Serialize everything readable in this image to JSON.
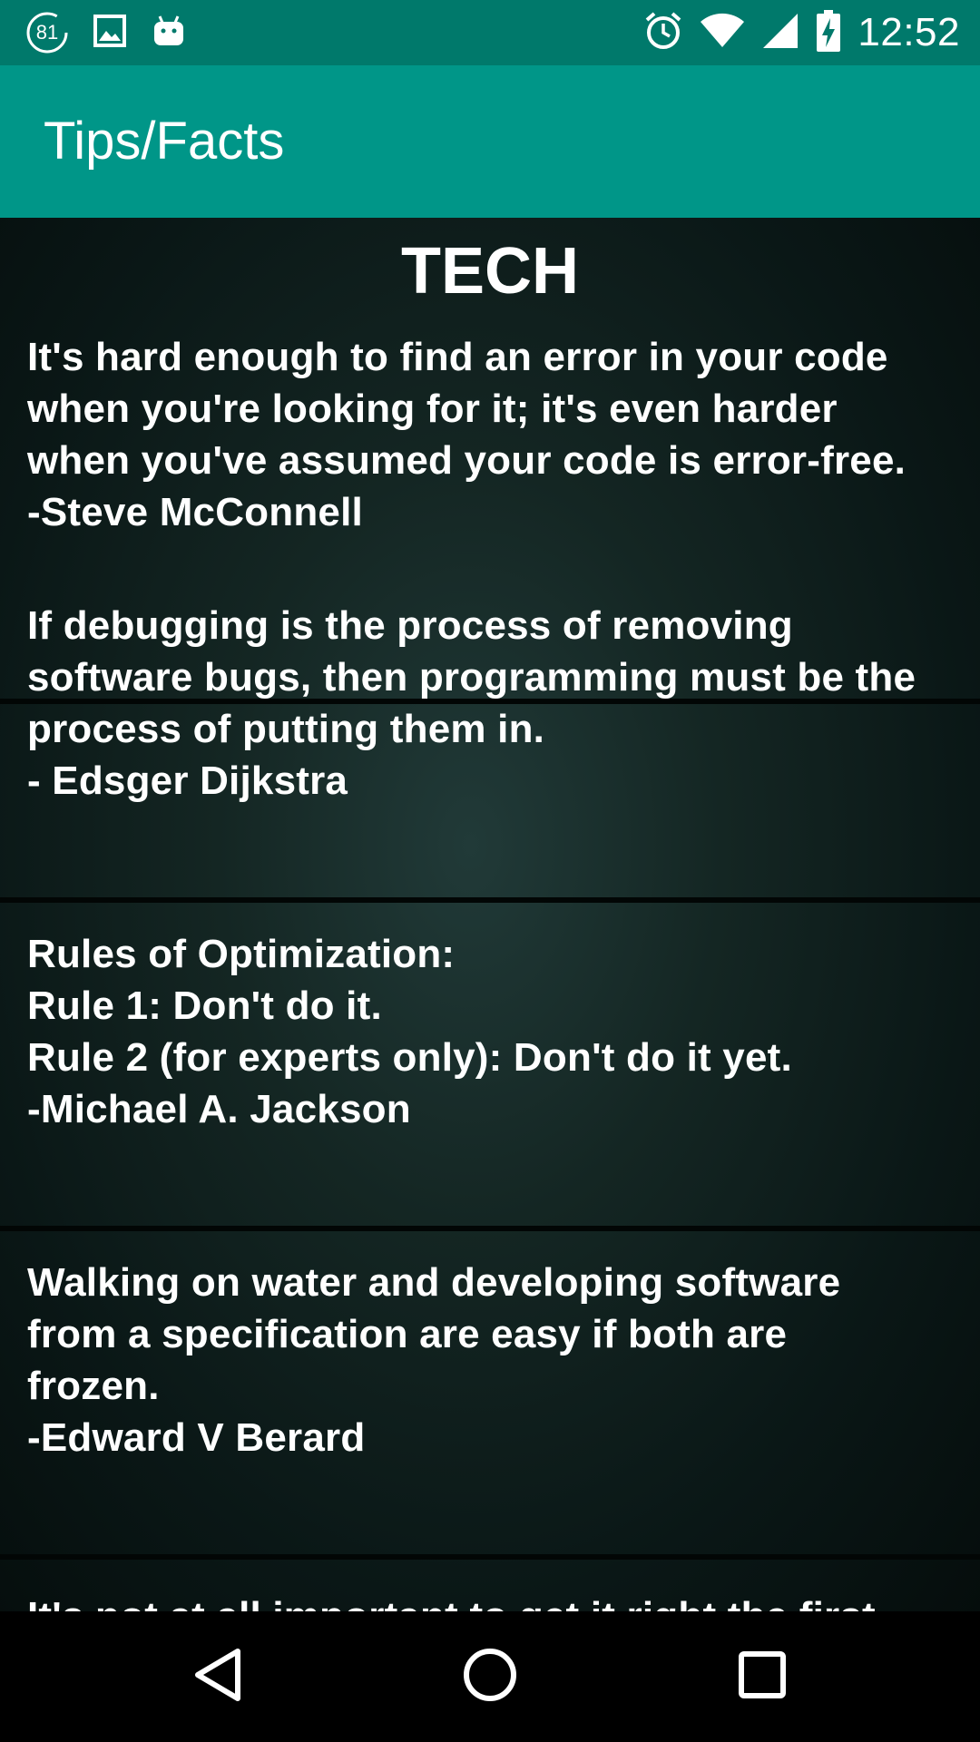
{
  "status_bar": {
    "notification_badge": "81",
    "clock": "12:52",
    "left_icons": [
      "notification-count-icon",
      "image-icon",
      "android-icon"
    ],
    "right_icons": [
      "alarm-icon",
      "wifi-icon",
      "signal-icon",
      "battery-charging-icon"
    ]
  },
  "app_bar": {
    "title": "Tips/Facts",
    "color": "#009688"
  },
  "section": {
    "heading": "TECH"
  },
  "quotes": [
    {
      "text": "It's hard enough to find an error in your code\nwhen you're looking for it; it's even harder\nwhen you've assumed your code is error-free.\n-Steve McConnell"
    },
    {
      "text": "If debugging is the process of removing\nsoftware bugs, then programming must be the\nprocess of putting them in.\n - Edsger Dijkstra"
    },
    {
      "text": "Rules of Optimization:\nRule 1: Don't do it.\nRule 2 (for experts only): Don't do it yet.\n -Michael A. Jackson"
    },
    {
      "text": "Walking on water and developing software\nfrom a specification are easy if both are\nfrozen.\n-Edward V Berard"
    },
    {
      "text": "It's not at all important to get it right the first"
    }
  ],
  "nav_bar": {
    "buttons": [
      "back-icon",
      "home-icon",
      "recents-icon"
    ]
  },
  "colors": {
    "status_bar": "#00796b",
    "app_bar": "#009688",
    "content_bg": "#0a1716",
    "text": "#ffffff"
  }
}
